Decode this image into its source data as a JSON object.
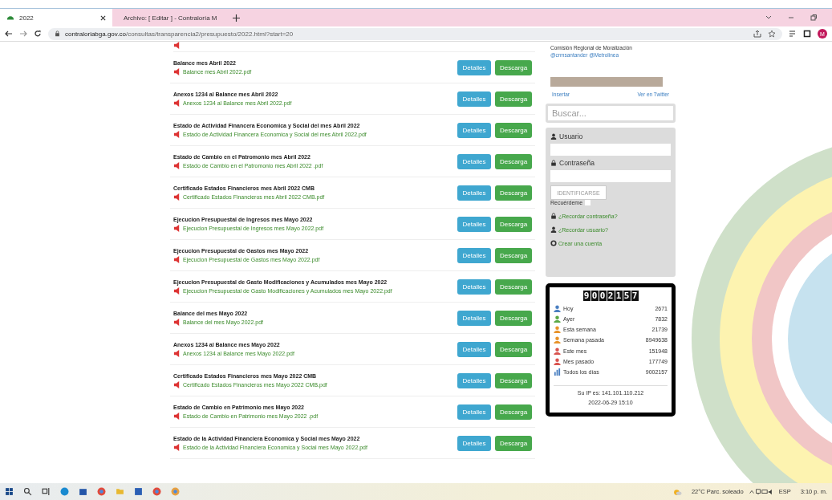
{
  "browser": {
    "tabs": [
      {
        "title": "2022",
        "selected": true
      },
      {
        "title": "Archivo: [ Editar ] - Contraloría M",
        "selected": false
      }
    ],
    "url_host": "contraloriabga.gov.co",
    "url_path": "/consultas/transparencia2/presupuesto/2022.html?start=20",
    "profile_initial": "M"
  },
  "documents": {
    "rows": [
      {
        "title": "Balance mes Abril 2022",
        "file": "Balance mes Abril 2022.pdf",
        "details": "Detalles",
        "download": "Descarga"
      },
      {
        "title": "Anexos 1234 al Balance mes Abril 2022",
        "file": "Anexos 1234 al Balance mes Abril 2022.pdf",
        "details": "Detalles",
        "download": "Descarga"
      },
      {
        "title": "Estado de Actividad Financera Economica y Social del mes Abril 2022",
        "file": "Estado de Actividad Financera Economica y Social del mes Abril 2022.pdf",
        "details": "Detalles",
        "download": "Descarga"
      },
      {
        "title": "Estado de Cambio en el Patromonio mes Abril 2022",
        "file": "Estado de Cambio en el Patromonio mes Abril 2022 .pdf",
        "details": "Detalles",
        "download": "Descarga"
      },
      {
        "title": "Certificado Estados Financieros mes Abril 2022 CMB",
        "file": "Certificado Estados Financieros mes Abril 2022 CMB.pdf",
        "details": "Detalles",
        "download": "Descarga"
      },
      {
        "title": "Ejecucion Presupuestal de Ingresos mes Mayo 2022",
        "file": "Ejecucion Presupuestal de Ingresos mes Mayo 2022.pdf",
        "details": "Detalles",
        "download": "Descarga"
      },
      {
        "title": "Ejecucion Presupuestal de Gastos mes Mayo 2022",
        "file": "Ejecucion Presupuestal de Gastos mes Mayo 2022.pdf",
        "details": "Detalles",
        "download": "Descarga"
      },
      {
        "title": "Ejecucion Presupuestal de Gasto Modificaciones y Acumulados mes Mayo 2022",
        "file": "Ejecucion Presupuestal de Gasto Modificaciones y Acumulados mes Mayo 2022.pdf",
        "details": "Detalles",
        "download": "Descarga"
      },
      {
        "title": "Balance del mes Mayo 2022",
        "file": "Balance del mes Mayo 2022.pdf",
        "details": "Detalles",
        "download": "Descarga"
      },
      {
        "title": "Anexos 1234 al Balance mes Mayo 2022",
        "file": "Anexos 1234 al Balance mes Mayo 2022.pdf",
        "details": "Detalles",
        "download": "Descarga"
      },
      {
        "title": "Certificado Estados Financieros mes Mayo 2022 CMB",
        "file": "Certificado Estados Financieros mes Mayo 2022 CMB.pdf",
        "details": "Detalles",
        "download": "Descarga"
      },
      {
        "title": "Estado de Cambio en Patrimonio mes Mayo 2022",
        "file": "Estado de Cambio en Patrimonio mes Mayo 2022 .pdf",
        "details": "Detalles",
        "download": "Descarga"
      },
      {
        "title": "Estado de la Actividad Financiera Economica y Social mes Mayo 2022",
        "file": "Estado de la Actividad Financiera Economica y Social mes Mayo 2022.pdf",
        "details": "Detalles",
        "download": "Descarga"
      }
    ]
  },
  "twitter": {
    "text": "Comisión Regional de Moralización",
    "mentions": "@crmsantander @Metrolinea",
    "embed_link": "Insertar",
    "view_link": "Ver en Twitter"
  },
  "search": {
    "placeholder": "Buscar..."
  },
  "login": {
    "user_label": "Usuario",
    "password_label": "Contraseña",
    "submit": "IDENTIFICARSE",
    "remember_label": "Recuérdeme",
    "remember": false,
    "links": [
      {
        "kind": "lock",
        "label": "¿Recordar contraseña?"
      },
      {
        "kind": "user",
        "label": "¿Recordar usuario?"
      },
      {
        "kind": "circle",
        "label": "Crear una cuenta"
      }
    ]
  },
  "counter": {
    "digits": [
      "9",
      "0",
      "0",
      "2",
      "1",
      "5",
      "7"
    ],
    "rows": [
      {
        "kind": "person",
        "color": "#4a7fc1",
        "label": "Hoy",
        "value": "2671"
      },
      {
        "kind": "person",
        "color": "#5aa845",
        "label": "Ayer",
        "value": "7832"
      },
      {
        "kind": "person",
        "color": "#e8932a",
        "label": "Esta semana",
        "value": "21739"
      },
      {
        "kind": "person",
        "color": "#e8932a",
        "label": "Semana pasada",
        "value": "8949638"
      },
      {
        "kind": "person",
        "color": "#d9534f",
        "label": "Este mes",
        "value": "151948"
      },
      {
        "kind": "person",
        "color": "#d9534f",
        "label": "Mes pasado",
        "value": "177749"
      },
      {
        "kind": "chart",
        "color": "#4a7fc1",
        "label": "Todos los días",
        "value": "9002157"
      }
    ],
    "ip": "Su IP es: 141.101.110.212",
    "datetime": "2022-06-29 15:10"
  },
  "taskbar": {
    "weather": "22°C  Parc. soleado",
    "language": "ESP",
    "time": "3:10 p. m."
  }
}
